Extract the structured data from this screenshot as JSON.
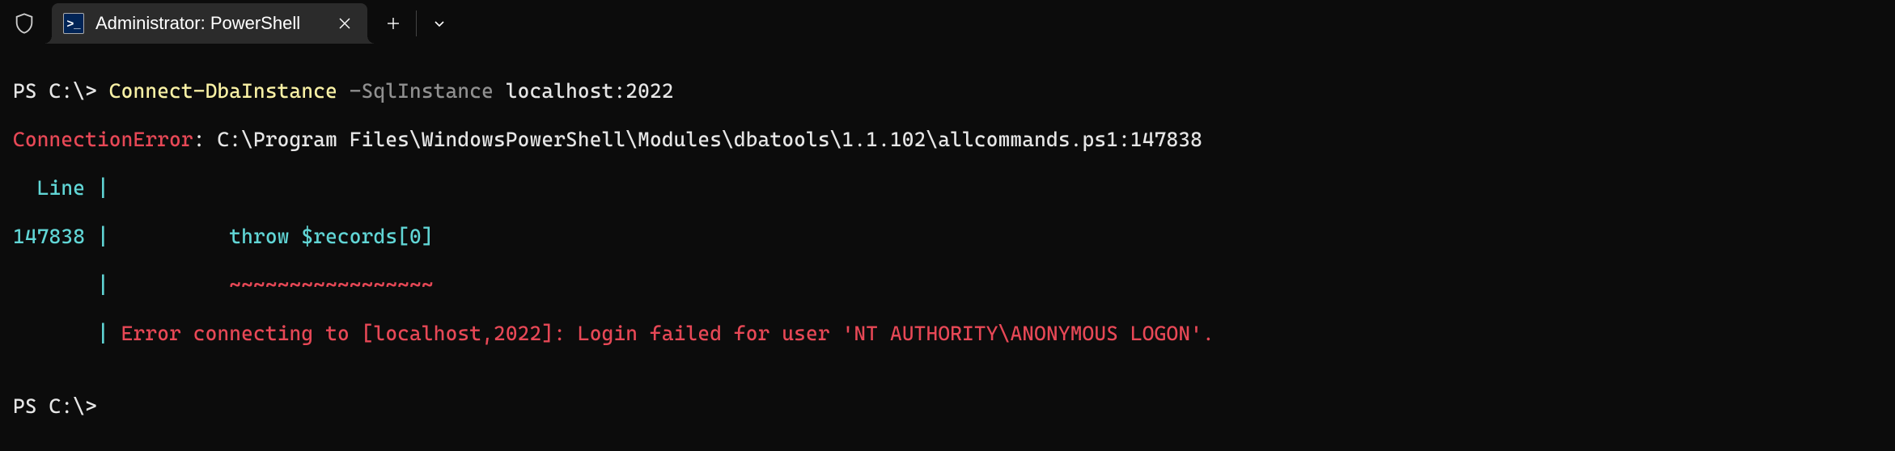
{
  "titlebar": {
    "tab": {
      "title": "Administrator: PowerShell"
    }
  },
  "terminal": {
    "line1": {
      "prompt": "PS C:\\> ",
      "cmdlet": "Connect-DbaInstance",
      "space1": " ",
      "param": "-SqlInstance",
      "space2": " ",
      "value": "localhost:2022"
    },
    "line2": {
      "label": "ConnectionError",
      "sep": ": ",
      "path": "C:\\Program Files\\WindowsPowerShell\\Modules\\dbatools\\1.1.102\\allcommands.ps1:147838"
    },
    "line3": {
      "col1_pad": "  ",
      "col1": "Line",
      "col1_post": " ",
      "pipe": "|"
    },
    "line4": {
      "col1": "147838",
      "col1_post": " ",
      "pipe": "|",
      "pad": "          ",
      "code": "throw $records[0]"
    },
    "line5": {
      "col1_pad": "       ",
      "pipe": "|",
      "pad": "          ",
      "tilde": "~~~~~~~~~~~~~~~~~"
    },
    "line6": {
      "col1_pad": "       ",
      "pipe": "|",
      "pad": " ",
      "msg": "Error connecting to [localhost,2022]: Login failed for user 'NT AUTHORITY\\ANONYMOUS LOGON'."
    },
    "blank": "",
    "line7": {
      "prompt": "PS C:\\>"
    }
  }
}
